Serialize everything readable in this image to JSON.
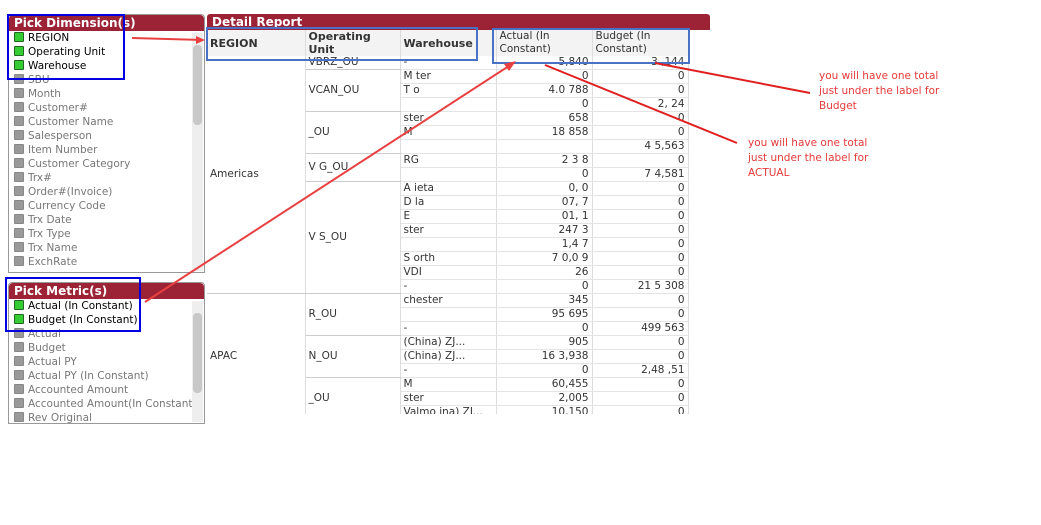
{
  "dimensions": {
    "title": "Pick Dimension(s)",
    "items": [
      {
        "label": "REGION",
        "selected": true
      },
      {
        "label": "Operating Unit",
        "selected": true
      },
      {
        "label": "Warehouse",
        "selected": true
      },
      {
        "label": "SBU",
        "selected": false
      },
      {
        "label": "Month",
        "selected": false
      },
      {
        "label": "Customer#",
        "selected": false
      },
      {
        "label": "Customer Name",
        "selected": false
      },
      {
        "label": "Salesperson",
        "selected": false
      },
      {
        "label": "Item Number",
        "selected": false
      },
      {
        "label": "Customer Category",
        "selected": false
      },
      {
        "label": "Trx#",
        "selected": false
      },
      {
        "label": "Order#(Invoice)",
        "selected": false
      },
      {
        "label": "Currency Code",
        "selected": false
      },
      {
        "label": "Trx Date",
        "selected": false
      },
      {
        "label": "Trx Type",
        "selected": false
      },
      {
        "label": "Trx Name",
        "selected": false
      },
      {
        "label": "ExchRate",
        "selected": false
      }
    ]
  },
  "metrics": {
    "title": "Pick Metric(s)",
    "items": [
      {
        "label": "Actual (In Constant)",
        "selected": true
      },
      {
        "label": "Budget (In Constant)",
        "selected": true
      },
      {
        "label": "Actual",
        "selected": false
      },
      {
        "label": "Budget",
        "selected": false
      },
      {
        "label": "Actual PY",
        "selected": false
      },
      {
        "label": "Actual PY (In Constant)",
        "selected": false
      },
      {
        "label": "Accounted Amount",
        "selected": false
      },
      {
        "label": "Accounted Amount(In Constant)",
        "selected": false
      },
      {
        "label": "Rev Original",
        "selected": false
      }
    ]
  },
  "report": {
    "title": "Detail Report",
    "columns": [
      "REGION",
      "Operating Unit",
      "Warehouse",
      "Actual (In Constant)",
      "Budget (In Constant)"
    ],
    "regions": [
      {
        "name": "Americas",
        "units": [
          {
            "name": "VBRZ_OU",
            "rows": [
              [
                "-",
                "5,840",
                "3 ,144"
              ]
            ]
          },
          {
            "name": "VCAN_OU",
            "rows": [
              [
                "M   ter",
                "  0",
                "0"
              ],
              [
                "T   o",
                "4.0 788",
                "0"
              ],
              [
                "",
                "0",
                "2, 24"
              ]
            ]
          },
          {
            "name": "   _OU",
            "rows": [
              [
                "   ster",
                "658",
                "0"
              ],
              [
                "  M",
                "18  858",
                "0"
              ],
              [
                "",
                "",
                "4  5,563"
              ]
            ]
          },
          {
            "name": "V  G_OU",
            "rows": [
              [
                "RG",
                "2  3 8",
                "0"
              ],
              [
                "",
                "0",
                "7  4,581"
              ]
            ]
          },
          {
            "name": "V   S_OU",
            "rows": [
              [
                "A   ieta",
                "0, 0",
                "0"
              ],
              [
                "D  la",
                "07,  7",
                "0"
              ],
              [
                "E",
                "01,  1",
                "0"
              ],
              [
                "   ster",
                "247  3",
                "0"
              ],
              [
                "",
                "1,4 7",
                "0"
              ],
              [
                "S   orth",
                "7 0,0 9",
                "0"
              ],
              [
                "VDI",
                "26",
                "0"
              ],
              [
                "-",
                "0",
                "21  5  308"
              ]
            ]
          }
        ]
      },
      {
        "name": "APAC",
        "units": [
          {
            "name": "   R_OU",
            "rows": [
              [
                "   chester",
                "  345",
                "0"
              ],
              [
                "  ",
                "95  695",
                "0"
              ],
              [
                "-",
                "0",
                "499  563"
              ]
            ]
          },
          {
            "name": "   N_OU",
            "rows": [
              [
                "   (China) ZJ...",
                "  905",
                "0"
              ],
              [
                "   (China) ZJ...",
                "16 3,938",
                "0"
              ],
              [
                "-",
                "0",
                "2,48 ,51"
              ]
            ]
          },
          {
            "name": "   _OU",
            "rows": [
              [
                "  M",
                "60,455",
                "0"
              ],
              [
                "   ster",
                "2,005",
                "0"
              ],
              [
                "Valmo   ina) ZJ...",
                "10,150",
                "0"
              ]
            ]
          }
        ]
      }
    ]
  },
  "annotations": {
    "budget_note": "you will have one total just under the label for Budget",
    "actual_note": "you will have one total just under the label for ACTUAL"
  },
  "colors": {
    "title_bar": "#9b2335",
    "highlight_box": "#0000e0",
    "label_box": "#4a72c4",
    "arrow": "#e84040",
    "note": "#e53a3a"
  }
}
